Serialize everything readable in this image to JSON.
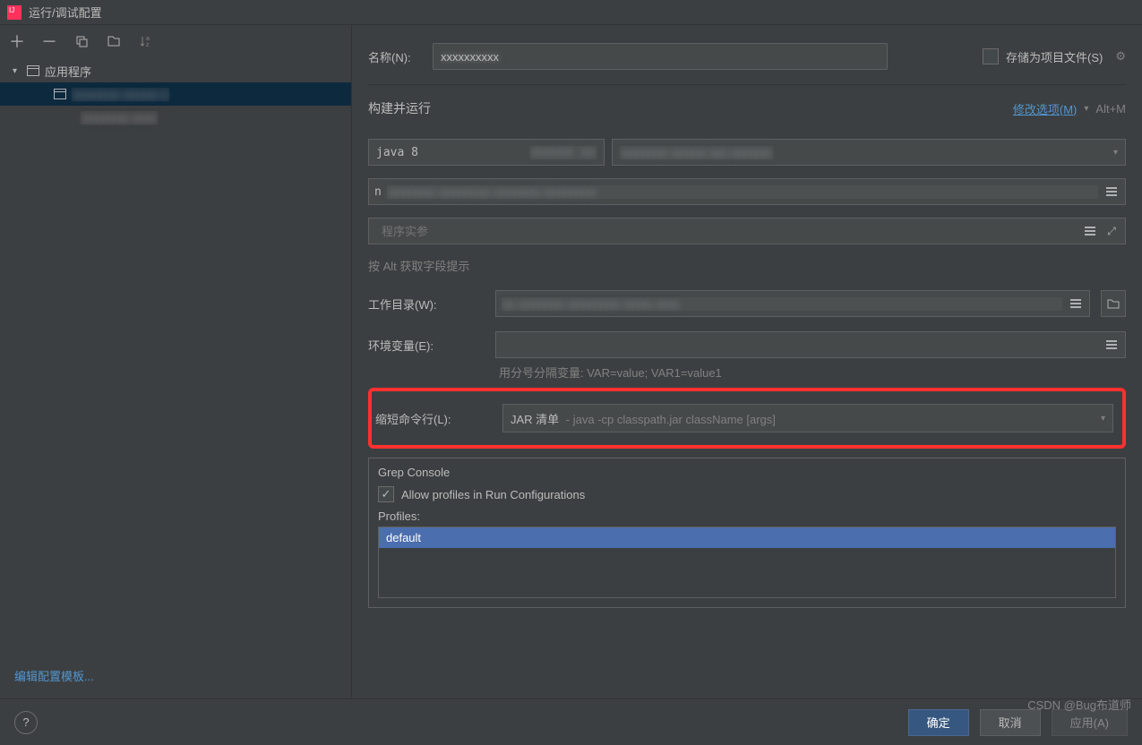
{
  "window": {
    "title": "运行/调试配置"
  },
  "sidebar": {
    "tree_root": "应用程序",
    "link_template": "编辑配置模板..."
  },
  "form": {
    "name_label": "名称(N):",
    "store_as_file": "存储为项目文件(S)",
    "section_title": "构建并运行",
    "modify_options": "修改选项(M)",
    "modify_shortcut": "Alt+M",
    "jdk_value": "java 8",
    "main_class_prefix": "n",
    "args_placeholder": "程序实参",
    "alt_hint": "按 Alt 获取字段提示",
    "workdir_label": "工作目录(W):",
    "env_label": "环境变量(E):",
    "env_hint": "用分号分隔变量: VAR=value; VAR1=value1",
    "shorten_label": "缩短命令行(L):",
    "shorten_value": "JAR 清单",
    "shorten_hint": "- java -cp classpath.jar className [args]"
  },
  "grep": {
    "legend": "Grep Console",
    "allow_profiles": "Allow profiles in Run Configurations",
    "profiles_label": "Profiles:",
    "profile_item": "default"
  },
  "buttons": {
    "ok": "确定",
    "cancel": "取消",
    "apply": "应用(A)"
  },
  "watermark": "CSDN @Bug布道师"
}
